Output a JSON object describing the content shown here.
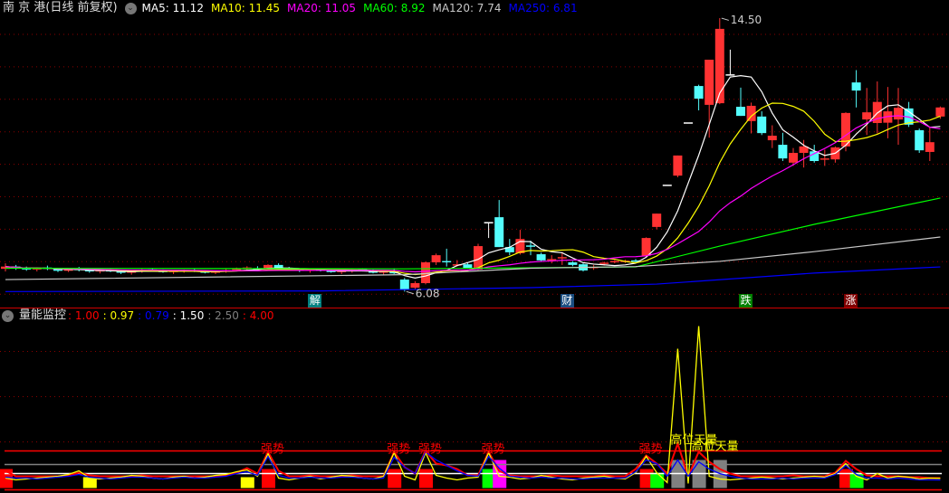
{
  "header": {
    "title": "南 京 港(日线 前复权)",
    "ma": [
      {
        "label": "MA5: 11.12",
        "color": "#ffffff"
      },
      {
        "label": "MA10: 11.45",
        "color": "#ffff00"
      },
      {
        "label": "MA20: 11.05",
        "color": "#ff00ff"
      },
      {
        "label": "MA60: 8.92",
        "color": "#00ff00"
      },
      {
        "label": "MA120: 7.74",
        "color": "#c8c8c8"
      },
      {
        "label": "MA250: 6.81",
        "color": "#0000ff"
      }
    ]
  },
  "indicator_header": {
    "title": "量能监控",
    "values": [
      {
        "label": ": 1.00",
        "color": "#ff0000"
      },
      {
        "label": ": 0.97",
        "color": "#ffff00"
      },
      {
        "label": ": 0.79",
        "color": "#0000ff"
      },
      {
        "label": ": 1.50",
        "color": "#ffffff"
      },
      {
        "label": ": 2.50",
        "color": "#808080"
      },
      {
        "label": ": 4.00",
        "color": "#ff0000"
      }
    ]
  },
  "events": [
    {
      "label": "解",
      "index": 29,
      "color": "#008080"
    },
    {
      "label": "财",
      "index": 53,
      "color": "#1a4d80"
    },
    {
      "label": "跌",
      "index": 70,
      "color": "#008000"
    },
    {
      "label": "涨",
      "index": 80,
      "color": "#800000"
    }
  ],
  "chart_data": [
    {
      "type": "candlestick",
      "title": "南 京 港(日线 前复权)",
      "ylim": [
        6.0,
        14.5
      ],
      "grid_prices": [
        14,
        13,
        12,
        11,
        10,
        9,
        8,
        7,
        6
      ],
      "max_label": {
        "text": "14.50",
        "index": 68
      },
      "min_label": {
        "text": "6.08",
        "index": 38
      },
      "colors": {
        "up": "#ff3232",
        "down": "#54fcfc",
        "flat": "#ffffff"
      },
      "candles": [
        [
          6.78,
          6.95,
          6.7,
          6.85
        ],
        [
          6.85,
          6.9,
          6.75,
          6.8
        ],
        [
          6.8,
          6.85,
          6.72,
          6.76
        ],
        [
          6.76,
          6.82,
          6.7,
          6.8
        ],
        [
          6.8,
          6.88,
          6.74,
          6.78
        ],
        [
          6.78,
          6.8,
          6.68,
          6.72
        ],
        [
          6.72,
          6.8,
          6.68,
          6.76
        ],
        [
          6.76,
          6.84,
          6.7,
          6.74
        ],
        [
          6.74,
          6.78,
          6.66,
          6.7
        ],
        [
          6.7,
          6.76,
          6.64,
          6.72
        ],
        [
          6.72,
          6.78,
          6.68,
          6.7
        ],
        [
          6.7,
          6.74,
          6.62,
          6.66
        ],
        [
          6.66,
          6.72,
          6.6,
          6.7
        ],
        [
          6.7,
          6.78,
          6.66,
          6.74
        ],
        [
          6.74,
          6.8,
          6.7,
          6.72
        ],
        [
          6.72,
          6.76,
          6.66,
          6.68
        ],
        [
          6.68,
          6.74,
          6.62,
          6.7
        ],
        [
          6.7,
          6.76,
          6.66,
          6.72
        ],
        [
          6.72,
          6.78,
          6.68,
          6.7
        ],
        [
          6.7,
          6.74,
          6.64,
          6.66
        ],
        [
          6.66,
          6.72,
          6.62,
          6.7
        ],
        [
          6.7,
          6.78,
          6.66,
          6.74
        ],
        [
          6.74,
          6.82,
          6.7,
          6.78
        ],
        [
          6.78,
          6.86,
          6.72,
          6.8
        ],
        [
          6.8,
          6.86,
          6.74,
          6.76
        ],
        [
          6.76,
          6.92,
          6.72,
          6.9
        ],
        [
          6.9,
          6.95,
          6.78,
          6.8
        ],
        [
          6.8,
          6.84,
          6.72,
          6.76
        ],
        [
          6.76,
          6.8,
          6.68,
          6.72
        ],
        [
          6.72,
          6.78,
          6.66,
          6.74
        ],
        [
          6.74,
          6.8,
          6.7,
          6.72
        ],
        [
          6.72,
          6.76,
          6.66,
          6.68
        ],
        [
          6.68,
          6.74,
          6.62,
          6.7
        ],
        [
          6.7,
          6.78,
          6.66,
          6.75
        ],
        [
          6.75,
          6.8,
          6.7,
          6.72
        ],
        [
          6.72,
          6.76,
          6.64,
          6.66
        ],
        [
          6.66,
          6.72,
          6.6,
          6.7
        ],
        [
          6.7,
          6.8,
          6.62,
          6.64
        ],
        [
          6.45,
          6.5,
          6.08,
          6.14
        ],
        [
          6.2,
          6.4,
          6.15,
          6.34
        ],
        [
          6.34,
          7.0,
          6.3,
          6.98
        ],
        [
          6.98,
          7.25,
          6.9,
          7.2
        ],
        [
          7.02,
          7.4,
          6.85,
          6.98
        ],
        [
          6.88,
          7.05,
          6.85,
          6.9
        ],
        [
          6.92,
          6.98,
          6.78,
          6.8
        ],
        [
          6.76,
          7.55,
          6.74,
          7.48
        ],
        [
          8.2,
          8.2,
          7.73,
          8.2
        ],
        [
          8.37,
          8.9,
          7.45,
          7.45
        ],
        [
          7.45,
          7.7,
          7.2,
          7.29
        ],
        [
          7.26,
          7.98,
          7.22,
          7.7
        ],
        [
          7.48,
          7.65,
          7.2,
          7.45
        ],
        [
          7.23,
          7.28,
          7.0,
          7.04
        ],
        [
          7.05,
          7.2,
          6.95,
          7.06
        ],
        [
          7.1,
          7.3,
          6.9,
          7.12
        ],
        [
          6.98,
          7.02,
          6.86,
          6.9
        ],
        [
          6.92,
          6.95,
          6.7,
          6.73
        ],
        [
          6.8,
          6.9,
          6.75,
          6.82
        ],
        [
          6.93,
          7.0,
          6.88,
          6.95
        ],
        [
          6.99,
          7.05,
          6.95,
          7.0
        ],
        [
          7.0,
          7.06,
          6.96,
          7.01
        ],
        [
          7.02,
          7.08,
          6.96,
          7.0
        ],
        [
          7.18,
          7.75,
          7.15,
          7.73
        ],
        [
          8.07,
          8.48,
          8.0,
          8.48
        ],
        [
          9.35,
          9.35,
          9.35,
          9.35
        ],
        [
          9.65,
          10.27,
          9.6,
          10.27
        ],
        [
          11.27,
          11.27,
          11.27,
          11.27
        ],
        [
          12.41,
          12.45,
          11.66,
          12.02
        ],
        [
          11.83,
          13.22,
          10.82,
          13.22
        ],
        [
          11.88,
          14.5,
          11.85,
          14.17
        ],
        [
          12.75,
          13.53,
          12.75,
          12.75
        ],
        [
          11.77,
          12.36,
          11.49,
          11.49
        ],
        [
          11.33,
          11.9,
          10.95,
          11.8
        ],
        [
          11.47,
          11.63,
          10.9,
          10.96
        ],
        [
          10.74,
          11.2,
          10.5,
          10.88
        ],
        [
          10.6,
          10.97,
          10.1,
          10.18
        ],
        [
          10.05,
          10.5,
          9.95,
          10.35
        ],
        [
          10.35,
          10.75,
          9.9,
          10.55
        ],
        [
          10.4,
          10.6,
          10.05,
          10.1
        ],
        [
          10.14,
          10.45,
          9.95,
          10.18
        ],
        [
          10.15,
          10.55,
          10.05,
          10.52
        ],
        [
          10.55,
          11.6,
          10.4,
          11.58
        ],
        [
          12.52,
          12.9,
          11.75,
          12.27
        ],
        [
          11.38,
          12.35,
          10.9,
          11.6
        ],
        [
          11.27,
          12.55,
          10.95,
          11.92
        ],
        [
          11.28,
          12.38,
          10.8,
          11.63
        ],
        [
          11.38,
          12.35,
          10.6,
          11.74
        ],
        [
          11.72,
          11.92,
          11.15,
          11.22
        ],
        [
          11.05,
          11.1,
          10.35,
          10.43
        ],
        [
          10.38,
          11.15,
          10.1,
          10.68
        ],
        [
          11.47,
          11.78,
          11.4,
          11.75
        ]
      ],
      "ma_lines": [
        {
          "name": "MA5",
          "period": 5,
          "color": "#ffffff"
        },
        {
          "name": "MA10",
          "period": 10,
          "color": "#ffff00"
        },
        {
          "name": "MA20",
          "period": 20,
          "color": "#ff00ff"
        },
        {
          "name": "MA60",
          "color": "#00ff00",
          "points": [
            [
              0,
              6.8
            ],
            [
              38,
              6.78
            ],
            [
              60,
              6.84
            ],
            [
              68,
              7.48
            ],
            [
              77,
              8.15
            ],
            [
              89,
              8.96
            ]
          ]
        },
        {
          "name": "MA120",
          "color": "#c8c8c8",
          "points": [
            [
              0,
              6.45
            ],
            [
              38,
              6.6
            ],
            [
              50,
              6.8
            ],
            [
              60,
              6.85
            ],
            [
              68,
              7.01
            ],
            [
              77,
              7.31
            ],
            [
              89,
              7.76
            ]
          ]
        },
        {
          "name": "MA250",
          "color": "#0000ff",
          "points": [
            [
              0,
              6.08
            ],
            [
              30,
              6.1
            ],
            [
              50,
              6.2
            ],
            [
              62,
              6.31
            ],
            [
              77,
              6.65
            ],
            [
              89,
              6.84
            ]
          ]
        }
      ]
    },
    {
      "type": "line",
      "title": "量能监控",
      "ylim": [
        0,
        18.5
      ],
      "grid_values": [
        15,
        10,
        5
      ],
      "hlines": [
        {
          "value": 4.0,
          "color": "#ff0000"
        },
        {
          "value": 2.5,
          "color": "#808080"
        },
        {
          "value": 1.5,
          "color": "#ffffff"
        },
        {
          "value": -0.3,
          "color": "#ff0000"
        }
      ],
      "series": [
        {
          "name": "red",
          "color": "#ff0000",
          "values": [
            1.8,
            1.2,
            1.2,
            1.2,
            1.2,
            1.2,
            1.3,
            1.6,
            1.3,
            1.2,
            1.2,
            1.2,
            1.2,
            1.3,
            1.2,
            1.2,
            1.2,
            1.2,
            1.2,
            1.2,
            1.2,
            1.3,
            1.6,
            2.1,
            1.5,
            3.9,
            1.8,
            1.2,
            1.2,
            1.3,
            1.2,
            1.2,
            1.2,
            1.3,
            1.2,
            1.2,
            1.2,
            3.9,
            2.2,
            1.5,
            4.0,
            2.6,
            2.4,
            2.0,
            1.3,
            1.3,
            3.9,
            1.8,
            1.3,
            1.2,
            1.2,
            1.2,
            1.3,
            1.2,
            1.2,
            1.2,
            1.2,
            1.3,
            1.2,
            1.2,
            2.0,
            3.5,
            2.6,
            1.5,
            4.8,
            1.2,
            3.9,
            2.8,
            2.0,
            1.5,
            1.2,
            1.2,
            1.2,
            1.2,
            1.2,
            1.3,
            1.2,
            1.2,
            1.2,
            1.6,
            2.9,
            2.0,
            1.3,
            1.2,
            1.2,
            1.2,
            1.1,
            1.1,
            1.0,
            1.0
          ]
        },
        {
          "name": "yellow",
          "color": "#ffff00",
          "values": [
            1.0,
            0.8,
            0.9,
            1.0,
            1.1,
            1.2,
            1.4,
            1.8,
            1.0,
            0.9,
            1.0,
            1.1,
            1.3,
            1.2,
            1.0,
            0.9,
            1.1,
            1.2,
            1.0,
            1.1,
            1.3,
            1.4,
            1.7,
            1.9,
            1.2,
            3.7,
            1.0,
            0.8,
            1.0,
            1.2,
            0.9,
            1.1,
            1.3,
            1.2,
            1.0,
            0.9,
            1.2,
            3.8,
            1.2,
            0.8,
            3.8,
            1.3,
            1.0,
            0.8,
            1.0,
            1.1,
            3.8,
            1.2,
            1.1,
            0.9,
            1.0,
            1.3,
            1.1,
            0.9,
            0.8,
            1.0,
            1.1,
            1.2,
            1.0,
            0.9,
            1.6,
            3.4,
            1.6,
            0.5,
            15.3,
            0.4,
            17.8,
            1.2,
            0.9,
            0.8,
            0.9,
            1.0,
            1.1,
            1.0,
            0.9,
            1.0,
            1.1,
            1.2,
            1.1,
            1.5,
            2.6,
            1.2,
            0.8,
            1.5,
            1.0,
            1.2,
            1.1,
            0.9,
            1.0,
            0.97
          ]
        },
        {
          "name": "blue",
          "color": "#0000ff",
          "values": [
            1.1,
            1.0,
            1.0,
            0.9,
            1.0,
            1.1,
            1.2,
            1.4,
            1.1,
            1.0,
            0.9,
            1.0,
            1.1,
            1.1,
            1.0,
            0.9,
            1.0,
            1.1,
            1.0,
            1.0,
            1.1,
            1.2,
            1.5,
            1.7,
            1.3,
            3.4,
            1.3,
            1.0,
            1.0,
            1.1,
            1.0,
            1.0,
            1.1,
            1.1,
            1.0,
            0.9,
            1.0,
            3.3,
            2.2,
            1.5,
            3.9,
            3.0,
            2.4,
            1.8,
            1.3,
            1.2,
            3.4,
            2.1,
            1.2,
            1.1,
            1.0,
            1.1,
            1.0,
            1.0,
            0.9,
            0.9,
            1.0,
            1.0,
            1.0,
            1.0,
            1.7,
            3.0,
            2.6,
            1.2,
            3.0,
            1.2,
            2.8,
            2.0,
            1.5,
            1.2,
            1.0,
            0.9,
            0.9,
            0.9,
            1.0,
            0.9,
            1.0,
            1.0,
            1.0,
            1.4,
            2.4,
            1.4,
            1.0,
            1.0,
            0.9,
            1.0,
            0.9,
            0.8,
            0.8,
            0.79
          ]
        }
      ],
      "bars": [
        {
          "index": 0,
          "value": 2.0,
          "color": "#ff0000"
        },
        {
          "index": 8,
          "value": 1.1,
          "color": "#ffff00"
        },
        {
          "index": 23,
          "value": 1.1,
          "color": "#ffff00"
        },
        {
          "index": 25,
          "value": 2.0,
          "color": "#ff0000"
        },
        {
          "index": 37,
          "value": 2.0,
          "color": "#ff0000"
        },
        {
          "index": 40,
          "value": 2.0,
          "color": "#ff0000"
        },
        {
          "index": 46,
          "value": 2.0,
          "color": "#00ff00"
        },
        {
          "index": 47,
          "value": 3.0,
          "color": "#ff00ff"
        },
        {
          "index": 61,
          "value": 2.0,
          "color": "#ff0000"
        },
        {
          "index": 62,
          "value": 1.6,
          "color": "#00ff00"
        },
        {
          "index": 64,
          "value": 3.0,
          "color": "#808080"
        },
        {
          "index": 66,
          "value": 3.0,
          "color": "#808080"
        },
        {
          "index": 68,
          "value": 3.0,
          "color": "#808080"
        },
        {
          "index": 80,
          "value": 2.0,
          "color": "#ff0000"
        },
        {
          "index": 81,
          "value": 1.6,
          "color": "#00ff00"
        }
      ],
      "annotations": [
        {
          "text": "强势",
          "index": 25,
          "value": 4.0,
          "color": "#ff0000"
        },
        {
          "text": "强势",
          "index": 37,
          "value": 4.0,
          "color": "#ff0000"
        },
        {
          "text": "强势",
          "index": 40,
          "value": 4.0,
          "color": "#ff0000"
        },
        {
          "text": "强势",
          "index": 46,
          "value": 4.0,
          "color": "#ff0000"
        },
        {
          "text": "强势",
          "index": 61,
          "value": 4.0,
          "color": "#ff0000"
        },
        {
          "text": "高位天量",
          "index": 64,
          "value": 5.0,
          "color": "#ffff00"
        },
        {
          "text": "高位天量",
          "index": 66,
          "value": 4.3,
          "color": "#ffff00"
        }
      ]
    }
  ]
}
